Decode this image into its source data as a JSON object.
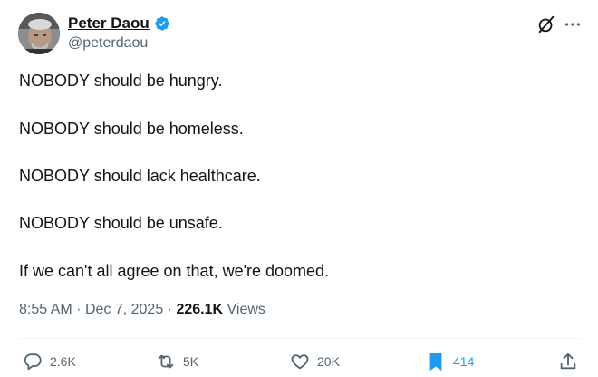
{
  "author": {
    "name": "Peter Daou",
    "handle": "@peterdaou"
  },
  "icons": {
    "verified": "verified-badge-icon",
    "grok": "grok-icon",
    "more": "more-icon",
    "reply": "reply-icon",
    "repost": "repost-icon",
    "like": "like-icon",
    "bookmark": "bookmark-icon",
    "share": "share-icon"
  },
  "colors": {
    "accent": "#1d9bf0",
    "text": "#0f1419",
    "secondary": "#536471"
  },
  "tweet": {
    "lines": [
      "NOBODY should be hungry.",
      "NOBODY should be homeless.",
      "NOBODY should lack healthcare.",
      "NOBODY should be unsafe.",
      "If we can't all agree on that, we're doomed."
    ]
  },
  "meta": {
    "time": "8:55 AM",
    "separator": "·",
    "date": "Dec 7, 2025",
    "views_count": "226.1K",
    "views_label": "Views"
  },
  "actions": {
    "replies": "2.6K",
    "reposts": "5K",
    "likes": "20K",
    "bookmarks": "414"
  }
}
